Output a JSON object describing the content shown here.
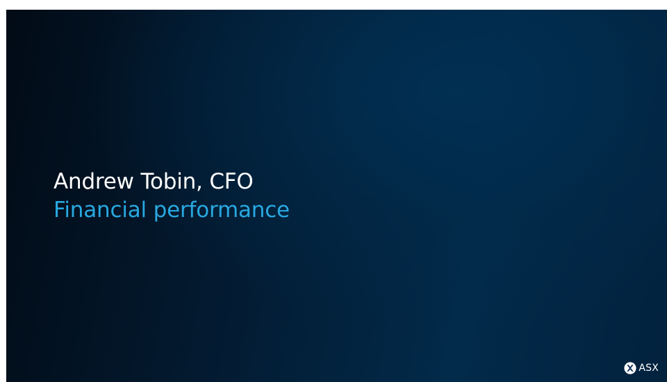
{
  "slide": {
    "presenter": "Andrew Tobin, CFO",
    "section_title": "Financial performance"
  },
  "logo": {
    "text": "ASX",
    "icon": "asx-logo-icon"
  },
  "colors": {
    "accent": "#29a8e0",
    "text": "#ffffff",
    "background_dark": "#020b16",
    "background_light": "#013054"
  }
}
